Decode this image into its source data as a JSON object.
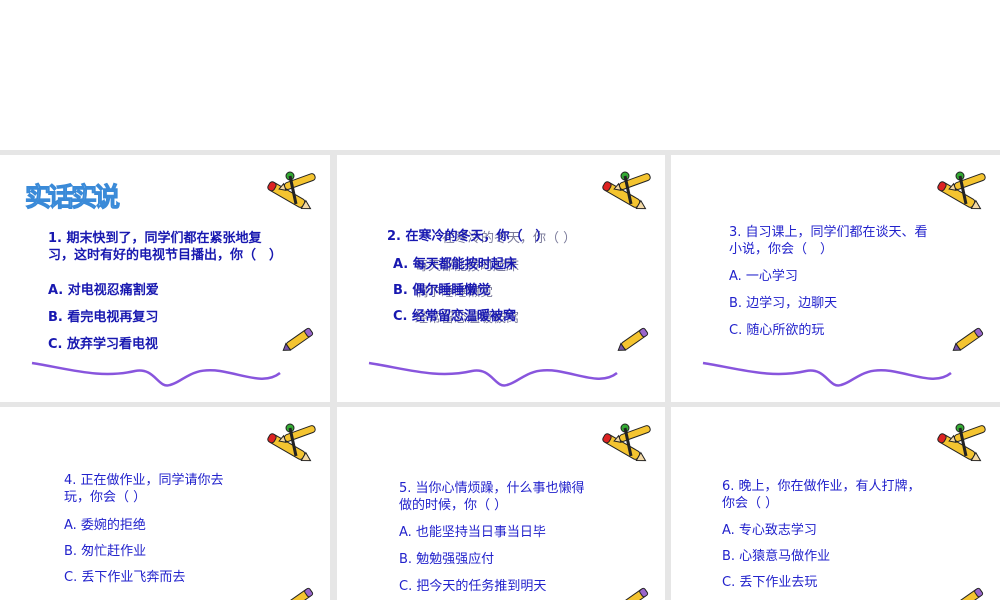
{
  "slides": [
    {
      "title": "实话实说",
      "question": [
        "1. 期末快到了，同学们都在紧张地复",
        "习，这时有好的电视节目播出，你（　）"
      ],
      "options": [
        "A. 对电视忍痛割爱",
        "B. 看完电视再复习",
        "C. 放弃学习看电视"
      ]
    },
    {
      "question": [
        "2. 在寒冷的冬天，你（　）"
      ],
      "options": [
        "A. 每天都能按时起床",
        "B. 偶尔睡睡懒觉",
        "C. 经常留恋温暖被窝"
      ],
      "ghost_question": "在寒冷的冬天，你（ ）",
      "ghost_options": [
        "每天都能按时起床",
        "偶尔睡睡懒觉",
        "经常留恋温暖被窝"
      ]
    },
    {
      "question": [
        "3. 自习课上，同学们都在谈天、看",
        "小说，你会（　）"
      ],
      "options": [
        "A. 一心学习",
        "B. 边学习，边聊天",
        "C. 随心所欲的玩"
      ]
    },
    {
      "question": [
        "4.  正在做作业，同学请你去",
        "玩，你会（ ）"
      ],
      "options": [
        "A. 委婉的拒绝",
        "B. 匆忙赶作业",
        "C. 丢下作业飞奔而去"
      ]
    },
    {
      "question": [
        "5.  当你心情烦躁，什么事也懒得",
        "做的时候，你（ ）"
      ],
      "options": [
        "A. 也能坚持当日事当日毕",
        "B. 勉勉强强应付",
        "C. 把今天的任务推到明天"
      ]
    },
    {
      "question": [
        "6. 晚上，你在做作业，有人打牌，",
        "你会（ ）"
      ],
      "options": [
        "A. 专心致志学习",
        "B. 心猿意马做作业",
        "C. 丢下作业去玩"
      ]
    }
  ],
  "colors": {
    "text": "#2222cc",
    "wave": "#8855dd",
    "gutter": "#e6e6e6"
  }
}
